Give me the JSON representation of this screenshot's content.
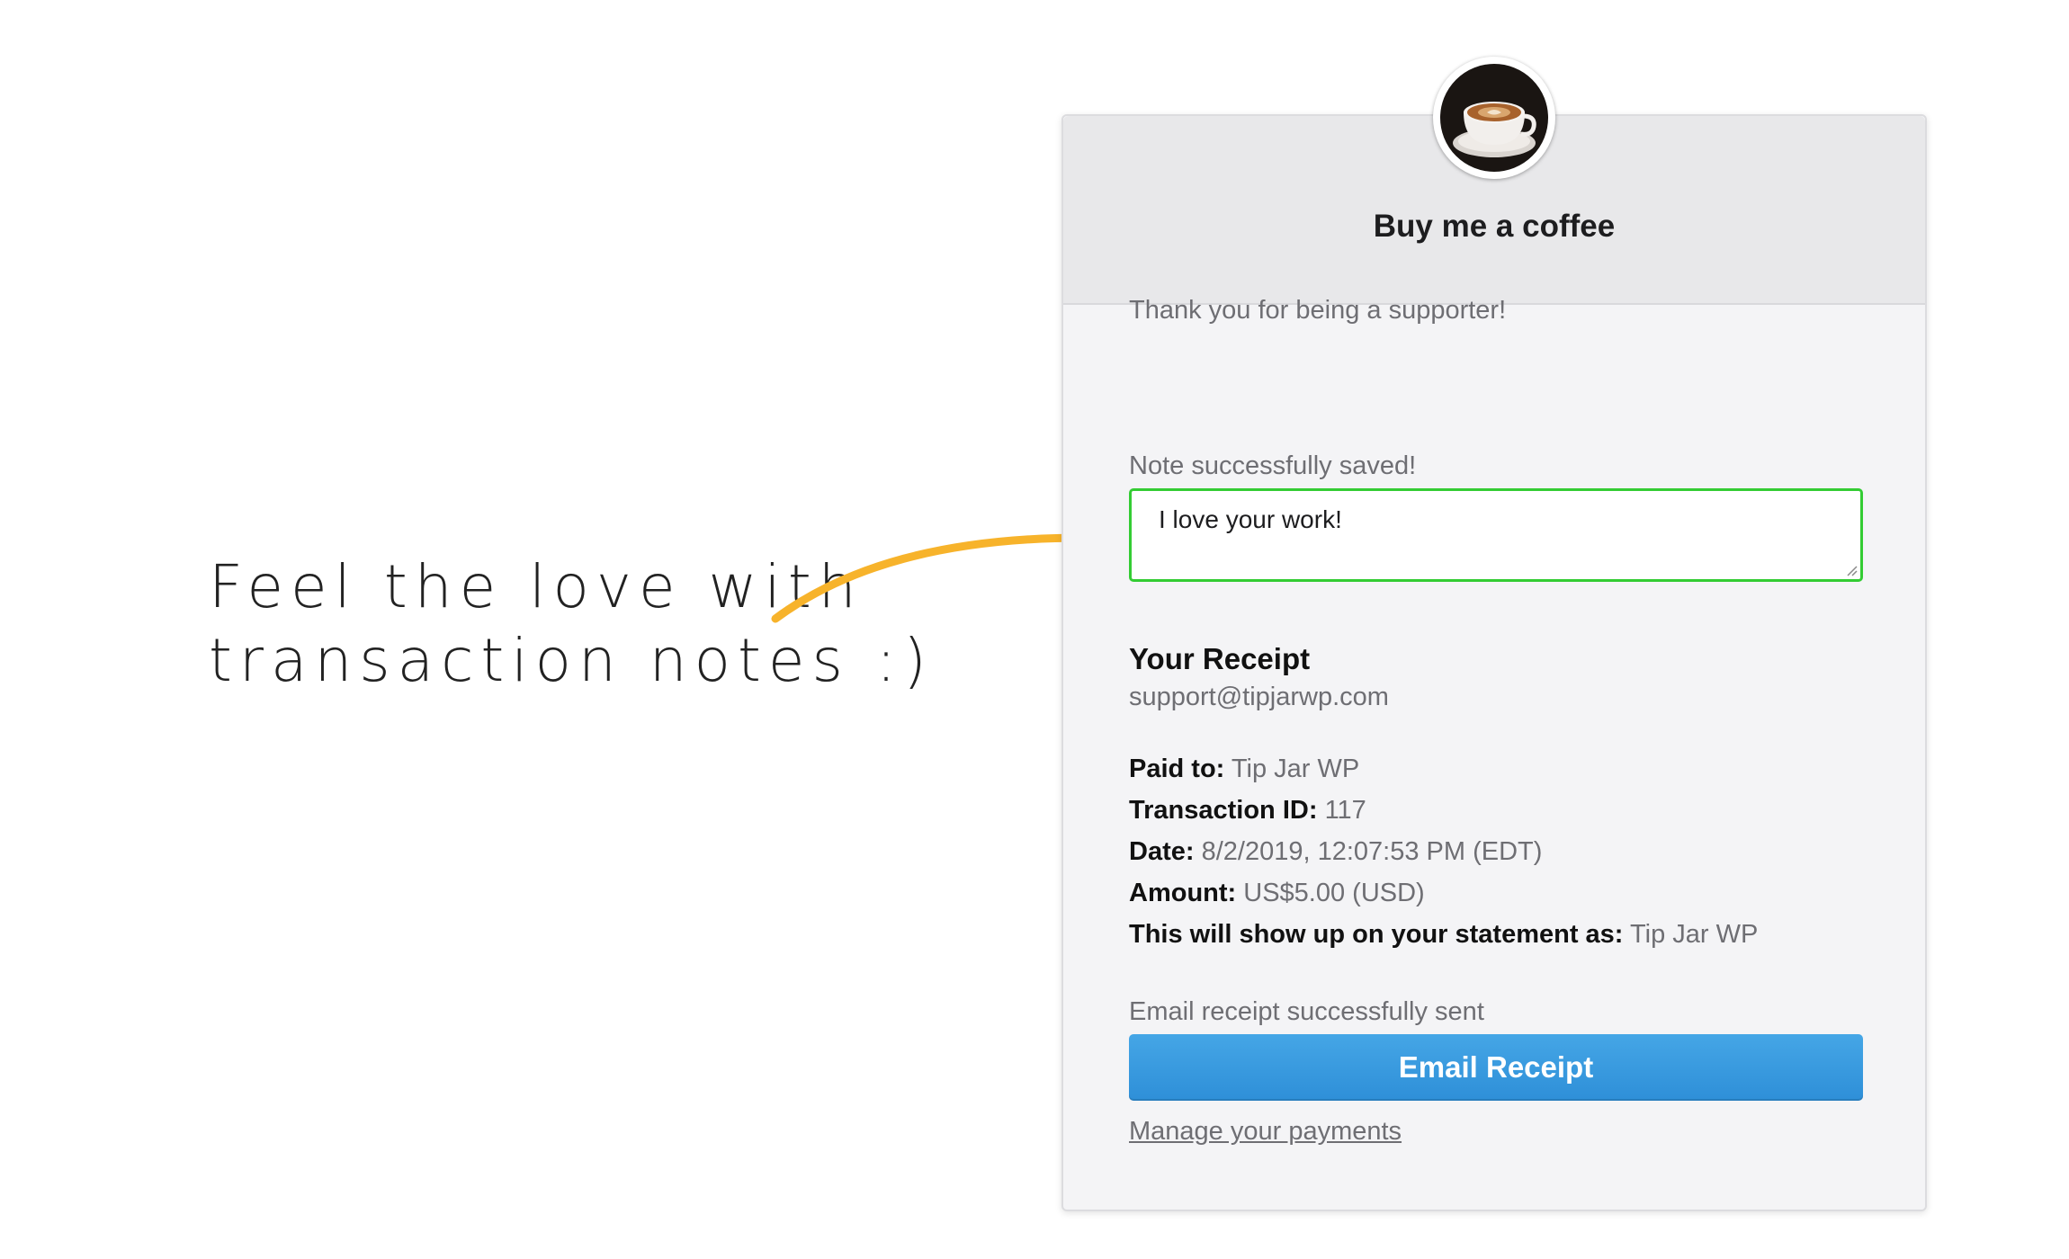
{
  "annotation": {
    "line1": "Feel the love with",
    "line2": "transaction notes :)",
    "arrow_color": "#f7b32b"
  },
  "card": {
    "title": "Buy me a coffee",
    "thanks_text": "Thank you for being a supporter!",
    "note_status": "Note successfully saved!",
    "note_value": "I love your work!",
    "note_border_color": "#33cc33",
    "receipt": {
      "title": "Your Receipt",
      "email": "support@tipjarwp.com",
      "lines": [
        {
          "label": "Paid to:",
          "value": "Tip Jar WP"
        },
        {
          "label": "Transaction ID:",
          "value": "117"
        },
        {
          "label": "Date:",
          "value": "8/2/2019, 12:07:53 PM (EDT)"
        },
        {
          "label": "Amount:",
          "value": "US$5.00 (USD)"
        },
        {
          "label": "This will show up on your statement as:",
          "value": "Tip Jar WP"
        }
      ]
    },
    "email_status": "Email receipt successfully sent",
    "email_button_label": "Email Receipt",
    "manage_link_label": "Manage your payments",
    "button_color": "#3a9de0"
  }
}
